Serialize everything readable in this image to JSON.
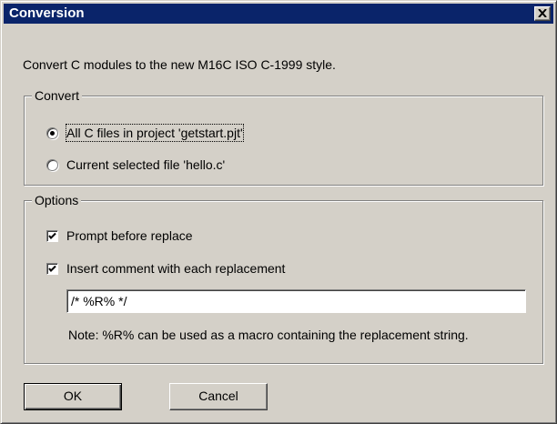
{
  "window": {
    "title": "Conversion"
  },
  "description": "Convert C modules to the new M16C ISO C-1999 style.",
  "convert_group": {
    "legend": "Convert",
    "options": [
      {
        "label": "All C files in project 'getstart.pjt'",
        "selected": true
      },
      {
        "label": "Current selected file 'hello.c'",
        "selected": false
      }
    ]
  },
  "options_group": {
    "legend": "Options",
    "prompt_before_replace": {
      "label": "Prompt before replace",
      "checked": true
    },
    "insert_comment": {
      "label": "Insert comment with each replacement",
      "checked": true
    },
    "comment_template": {
      "value": "/* %R% */"
    },
    "note": "Note: %R% can be used as a macro containing the replacement string."
  },
  "buttons": {
    "ok": "OK",
    "cancel": "Cancel"
  },
  "icons": {
    "close": "close-icon",
    "check": "check-icon"
  }
}
